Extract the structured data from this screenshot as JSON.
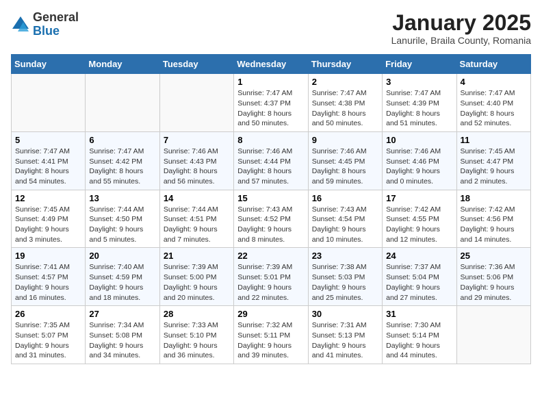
{
  "header": {
    "logo_general": "General",
    "logo_blue": "Blue",
    "title": "January 2025",
    "subtitle": "Lanurile, Braila County, Romania"
  },
  "weekdays": [
    "Sunday",
    "Monday",
    "Tuesday",
    "Wednesday",
    "Thursday",
    "Friday",
    "Saturday"
  ],
  "weeks": [
    [
      {
        "day": "",
        "info": ""
      },
      {
        "day": "",
        "info": ""
      },
      {
        "day": "",
        "info": ""
      },
      {
        "day": "1",
        "info": "Sunrise: 7:47 AM\nSunset: 4:37 PM\nDaylight: 8 hours\nand 50 minutes."
      },
      {
        "day": "2",
        "info": "Sunrise: 7:47 AM\nSunset: 4:38 PM\nDaylight: 8 hours\nand 50 minutes."
      },
      {
        "day": "3",
        "info": "Sunrise: 7:47 AM\nSunset: 4:39 PM\nDaylight: 8 hours\nand 51 minutes."
      },
      {
        "day": "4",
        "info": "Sunrise: 7:47 AM\nSunset: 4:40 PM\nDaylight: 8 hours\nand 52 minutes."
      }
    ],
    [
      {
        "day": "5",
        "info": "Sunrise: 7:47 AM\nSunset: 4:41 PM\nDaylight: 8 hours\nand 54 minutes."
      },
      {
        "day": "6",
        "info": "Sunrise: 7:47 AM\nSunset: 4:42 PM\nDaylight: 8 hours\nand 55 minutes."
      },
      {
        "day": "7",
        "info": "Sunrise: 7:46 AM\nSunset: 4:43 PM\nDaylight: 8 hours\nand 56 minutes."
      },
      {
        "day": "8",
        "info": "Sunrise: 7:46 AM\nSunset: 4:44 PM\nDaylight: 8 hours\nand 57 minutes."
      },
      {
        "day": "9",
        "info": "Sunrise: 7:46 AM\nSunset: 4:45 PM\nDaylight: 8 hours\nand 59 minutes."
      },
      {
        "day": "10",
        "info": "Sunrise: 7:46 AM\nSunset: 4:46 PM\nDaylight: 9 hours\nand 0 minutes."
      },
      {
        "day": "11",
        "info": "Sunrise: 7:45 AM\nSunset: 4:47 PM\nDaylight: 9 hours\nand 2 minutes."
      }
    ],
    [
      {
        "day": "12",
        "info": "Sunrise: 7:45 AM\nSunset: 4:49 PM\nDaylight: 9 hours\nand 3 minutes."
      },
      {
        "day": "13",
        "info": "Sunrise: 7:44 AM\nSunset: 4:50 PM\nDaylight: 9 hours\nand 5 minutes."
      },
      {
        "day": "14",
        "info": "Sunrise: 7:44 AM\nSunset: 4:51 PM\nDaylight: 9 hours\nand 7 minutes."
      },
      {
        "day": "15",
        "info": "Sunrise: 7:43 AM\nSunset: 4:52 PM\nDaylight: 9 hours\nand 8 minutes."
      },
      {
        "day": "16",
        "info": "Sunrise: 7:43 AM\nSunset: 4:54 PM\nDaylight: 9 hours\nand 10 minutes."
      },
      {
        "day": "17",
        "info": "Sunrise: 7:42 AM\nSunset: 4:55 PM\nDaylight: 9 hours\nand 12 minutes."
      },
      {
        "day": "18",
        "info": "Sunrise: 7:42 AM\nSunset: 4:56 PM\nDaylight: 9 hours\nand 14 minutes."
      }
    ],
    [
      {
        "day": "19",
        "info": "Sunrise: 7:41 AM\nSunset: 4:57 PM\nDaylight: 9 hours\nand 16 minutes."
      },
      {
        "day": "20",
        "info": "Sunrise: 7:40 AM\nSunset: 4:59 PM\nDaylight: 9 hours\nand 18 minutes."
      },
      {
        "day": "21",
        "info": "Sunrise: 7:39 AM\nSunset: 5:00 PM\nDaylight: 9 hours\nand 20 minutes."
      },
      {
        "day": "22",
        "info": "Sunrise: 7:39 AM\nSunset: 5:01 PM\nDaylight: 9 hours\nand 22 minutes."
      },
      {
        "day": "23",
        "info": "Sunrise: 7:38 AM\nSunset: 5:03 PM\nDaylight: 9 hours\nand 25 minutes."
      },
      {
        "day": "24",
        "info": "Sunrise: 7:37 AM\nSunset: 5:04 PM\nDaylight: 9 hours\nand 27 minutes."
      },
      {
        "day": "25",
        "info": "Sunrise: 7:36 AM\nSunset: 5:06 PM\nDaylight: 9 hours\nand 29 minutes."
      }
    ],
    [
      {
        "day": "26",
        "info": "Sunrise: 7:35 AM\nSunset: 5:07 PM\nDaylight: 9 hours\nand 31 minutes."
      },
      {
        "day": "27",
        "info": "Sunrise: 7:34 AM\nSunset: 5:08 PM\nDaylight: 9 hours\nand 34 minutes."
      },
      {
        "day": "28",
        "info": "Sunrise: 7:33 AM\nSunset: 5:10 PM\nDaylight: 9 hours\nand 36 minutes."
      },
      {
        "day": "29",
        "info": "Sunrise: 7:32 AM\nSunset: 5:11 PM\nDaylight: 9 hours\nand 39 minutes."
      },
      {
        "day": "30",
        "info": "Sunrise: 7:31 AM\nSunset: 5:13 PM\nDaylight: 9 hours\nand 41 minutes."
      },
      {
        "day": "31",
        "info": "Sunrise: 7:30 AM\nSunset: 5:14 PM\nDaylight: 9 hours\nand 44 minutes."
      },
      {
        "day": "",
        "info": ""
      }
    ]
  ]
}
